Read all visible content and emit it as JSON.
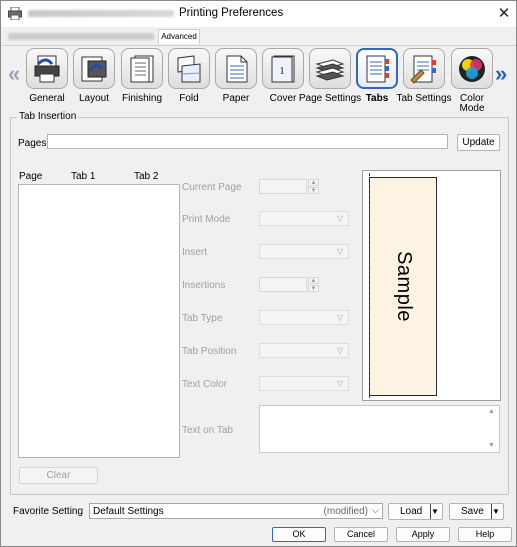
{
  "window": {
    "title": "Printing Preferences",
    "close_glyph": "✕"
  },
  "tabs": {
    "advanced": "Advanced"
  },
  "iconbar": {
    "left_arrow": "«",
    "right_arrow": "»",
    "items": [
      {
        "label": "General",
        "icon": "general-icon"
      },
      {
        "label": "Layout",
        "icon": "layout-icon"
      },
      {
        "label": "Finishing",
        "icon": "finishing-icon"
      },
      {
        "label": "Fold",
        "icon": "fold-icon"
      },
      {
        "label": "Paper",
        "icon": "paper-icon"
      },
      {
        "label": "Cover",
        "icon": "cover-icon"
      },
      {
        "label": "Page Settings",
        "icon": "page-settings-icon"
      },
      {
        "label": "Tabs",
        "icon": "tabs-icon",
        "active": true
      },
      {
        "label": "Tab Settings",
        "icon": "tab-settings-icon"
      },
      {
        "label": "Color Mode",
        "icon": "color-mode-icon"
      }
    ],
    "cover_glyph": "1"
  },
  "tab_insertion": {
    "group_title": "Tab Insertion",
    "pages_label": "Pages",
    "pages_value": "",
    "update_button": "Update",
    "list_headers": {
      "page": "Page",
      "tab1": "Tab 1",
      "tab2": "Tab 2"
    },
    "clear_button": "Clear",
    "fields": {
      "current_page": "Current Page",
      "print_mode": "Print Mode",
      "insert": "Insert",
      "insertions": "Insertions",
      "tab_type": "Tab Type",
      "tab_position": "Tab Position",
      "text_color": "Text Color",
      "text_on_tab": "Text on Tab"
    },
    "sample_text": "Sample"
  },
  "footer": {
    "favorite_label": "Favorite Setting",
    "favorite_value": "Default Settings",
    "favorite_modified": "(modified)",
    "load_button": "Load",
    "save_button": "Save",
    "ok_button": "OK",
    "cancel_button": "Cancel",
    "apply_button": "Apply",
    "help_button": "Help"
  },
  "colors": {
    "accent": "#2e66c9",
    "sample_fill": "#fcf3e3"
  }
}
